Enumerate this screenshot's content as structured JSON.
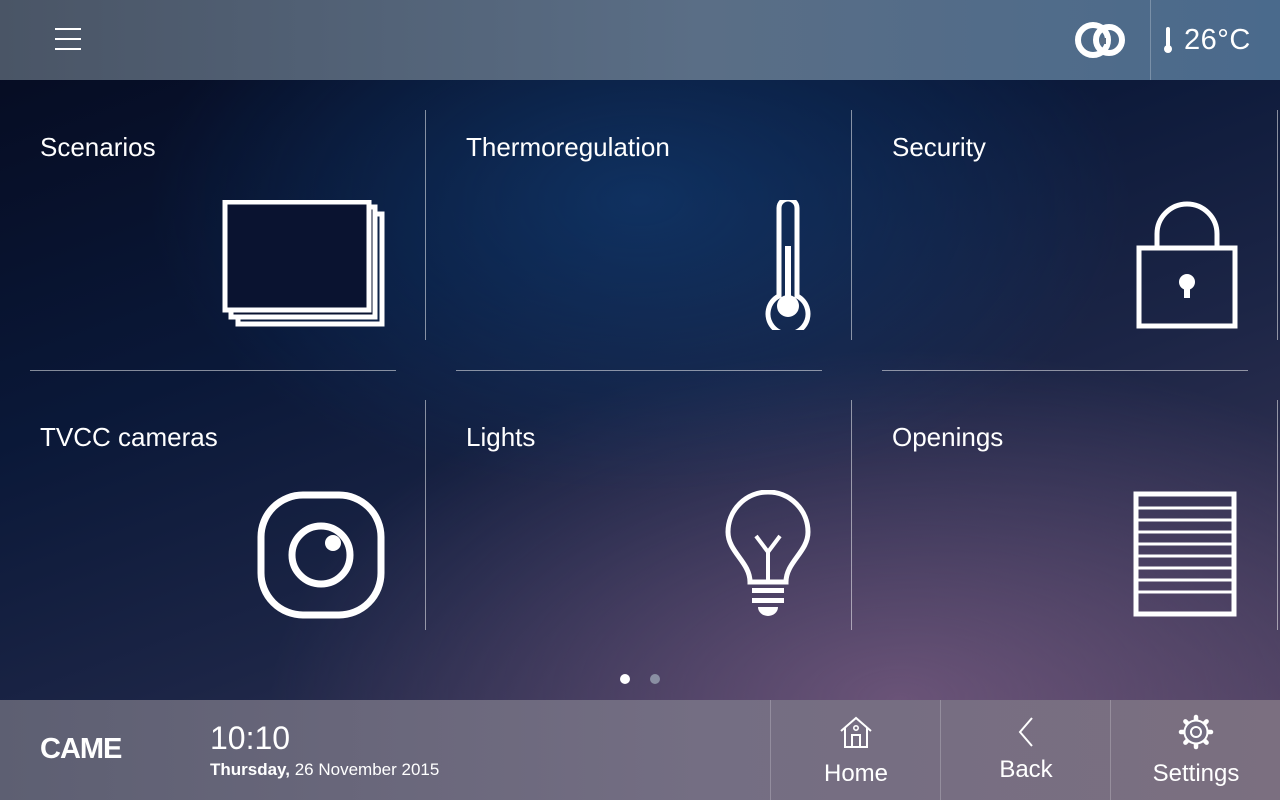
{
  "header": {
    "menu_icon": "hamburger-menu-icon",
    "cloud_icon": "cloud-link-icon",
    "temperature_icon": "thermometer-icon",
    "temperature": "26°C"
  },
  "tiles": [
    {
      "label": "Scenarios",
      "icon": "scenarios-stack-icon"
    },
    {
      "label": "Thermoregulation",
      "icon": "thermometer-icon"
    },
    {
      "label": "Security",
      "icon": "padlock-icon"
    },
    {
      "label": "TVCC cameras",
      "icon": "camera-icon"
    },
    {
      "label": "Lights",
      "icon": "lightbulb-icon"
    },
    {
      "label": "Openings",
      "icon": "shutter-icon"
    }
  ],
  "pagination": {
    "pages": 2,
    "current": 1
  },
  "footer": {
    "brand": "CAME",
    "time": "10:10",
    "day": "Thursday,",
    "date": "26 November 2015",
    "nav": [
      {
        "label": "Home",
        "icon": "home-icon"
      },
      {
        "label": "Back",
        "icon": "chevron-left-icon"
      },
      {
        "label": "Settings",
        "icon": "gear-icon"
      }
    ]
  },
  "colors": {
    "text": "#ffffff",
    "dot_active": "#ffffff",
    "dot_inactive": "#8a8fa3"
  }
}
